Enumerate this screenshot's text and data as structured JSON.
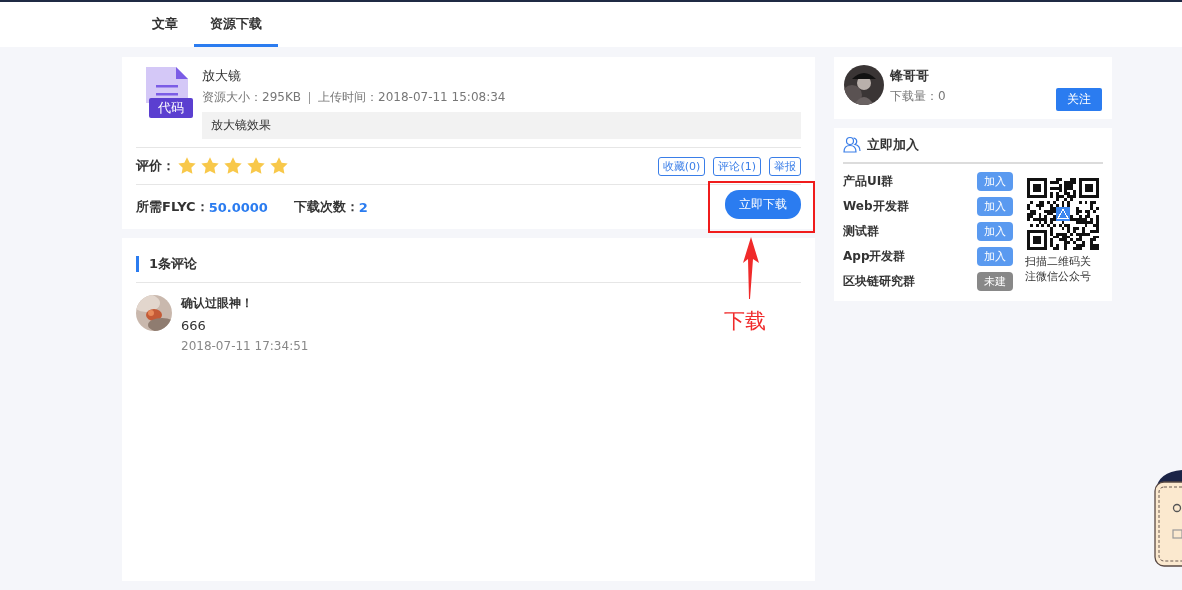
{
  "tabs": [
    {
      "label": "文章",
      "selected": false
    },
    {
      "label": "资源下载",
      "selected": true
    }
  ],
  "resource": {
    "badge": "代码",
    "title": "放大镜",
    "size_label": "资源大小：295KB",
    "upload_label": "上传时间：2018-07-11 15:08:34",
    "description": "放大镜效果",
    "rating_label": "评价：",
    "stars": 5,
    "actions": [
      "收藏(0)",
      "评论(1)",
      "举报"
    ],
    "cost_label": "所需FLYC：",
    "cost_value": "50.0000",
    "downloads_label": "下载次数：",
    "downloads_value": "2",
    "download_button": "立即下载"
  },
  "annotation": {
    "text": "下载"
  },
  "comments": {
    "heading": "1条评论",
    "items": [
      {
        "title": "确认过眼神！",
        "body": "666",
        "time": "2018-07-11 17:34:51"
      }
    ]
  },
  "author": {
    "name": "锋哥哥",
    "downloads": "下载量：0",
    "follow_button": "关注"
  },
  "groups": {
    "heading": "立即加入",
    "items": [
      {
        "name": "产品UI群",
        "button": "加入",
        "disabled": false
      },
      {
        "name": "Web开发群",
        "button": "加入",
        "disabled": false
      },
      {
        "name": "测试群",
        "button": "加入",
        "disabled": false
      },
      {
        "name": "App开发群",
        "button": "加入",
        "disabled": false
      },
      {
        "name": "区块链研究群",
        "button": "未建",
        "disabled": true
      }
    ],
    "qr_caption": "扫描二维码关注微信公众号"
  }
}
